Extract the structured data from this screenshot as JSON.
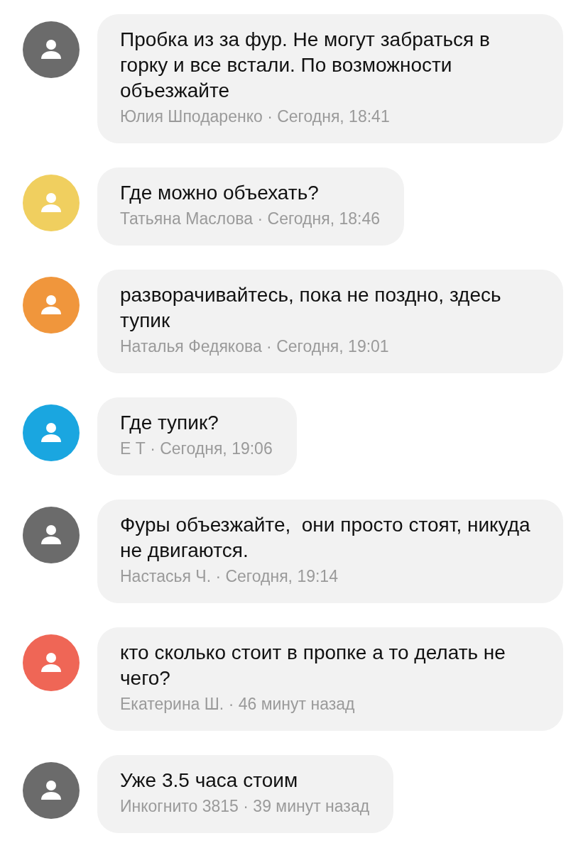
{
  "comments": [
    {
      "text": "Пробка из за фур. Не могут забраться в горку и все встали. По возможности объезжайте",
      "meta": "Юлия Шподаренко · Сегодня, 18:41",
      "color": "#6b6b6b"
    },
    {
      "text": "Где можно объехать?",
      "meta": "Татьяна Маслова · Сегодня, 18:46",
      "color": "#f0cf5f"
    },
    {
      "text": "разворачивайтесь, пока не поздно, здесь тупик",
      "meta": "Наталья Федякова · Сегодня, 19:01",
      "color": "#f0963c"
    },
    {
      "text": "Где тупик?",
      "meta": "Е Т · Сегодня, 19:06",
      "color": "#1aa6e0"
    },
    {
      "text": "Фуры объезжайте,  они просто стоят, никуда не двигаются.",
      "meta": "Настасья Ч. · Сегодня, 19:14",
      "color": "#6b6b6b"
    },
    {
      "text": "кто сколько стоит в пропке а то делать не чего?",
      "meta": "Екатерина Ш. · 46 минут назад",
      "color": "#ef6656"
    },
    {
      "text": "Уже 3.5 часа стоим",
      "meta": "Инкогнито 3815 · 39 минут назад",
      "color": "#6b6b6b"
    }
  ]
}
